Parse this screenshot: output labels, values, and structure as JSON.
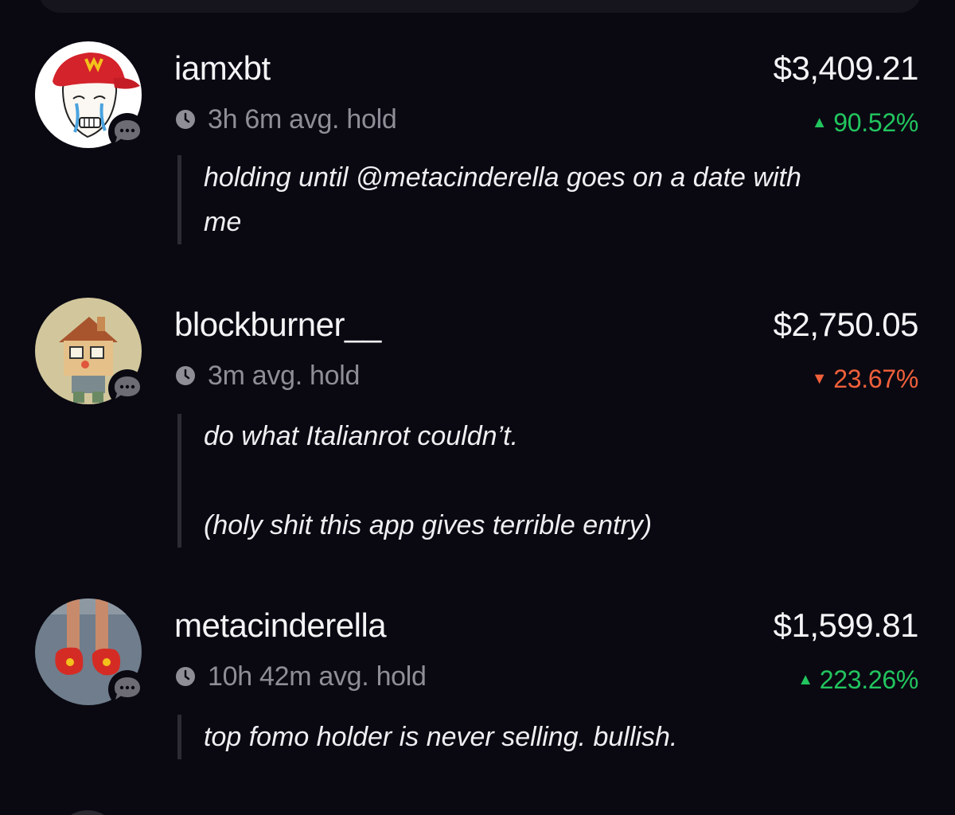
{
  "holders": [
    {
      "username": "iamxbt",
      "amount": "$3,409.21",
      "hold_time": "3h 6m avg. hold",
      "change": "90.52%",
      "direction": "up",
      "direction_symbol": "▲",
      "comment_lines": [
        "holding until @metacinderella goes on a date with",
        "me"
      ],
      "avatar_icon": "wojak-red-cap-avatar"
    },
    {
      "username": "blockburner__",
      "amount": "$2,750.05",
      "hold_time": "3m avg. hold",
      "change": "23.67%",
      "direction": "down",
      "direction_symbol": "▼",
      "comment_lines": [
        "do what Italianrot couldn’t.",
        " ",
        "(holy shit this app gives terrible entry)"
      ],
      "avatar_icon": "house-head-character-avatar"
    },
    {
      "username": "metacinderella",
      "amount": "$1,599.81",
      "hold_time": "10h 42m avg. hold",
      "change": "223.26%",
      "direction": "up",
      "direction_symbol": "▲",
      "comment_lines": [
        "top fomo holder is never selling. bullish."
      ],
      "avatar_icon": "red-shoes-photo-avatar"
    }
  ],
  "colors": {
    "background": "#0a0912",
    "positive": "#22c55e",
    "negative": "#f0603a",
    "muted_text": "#8f8e97"
  }
}
